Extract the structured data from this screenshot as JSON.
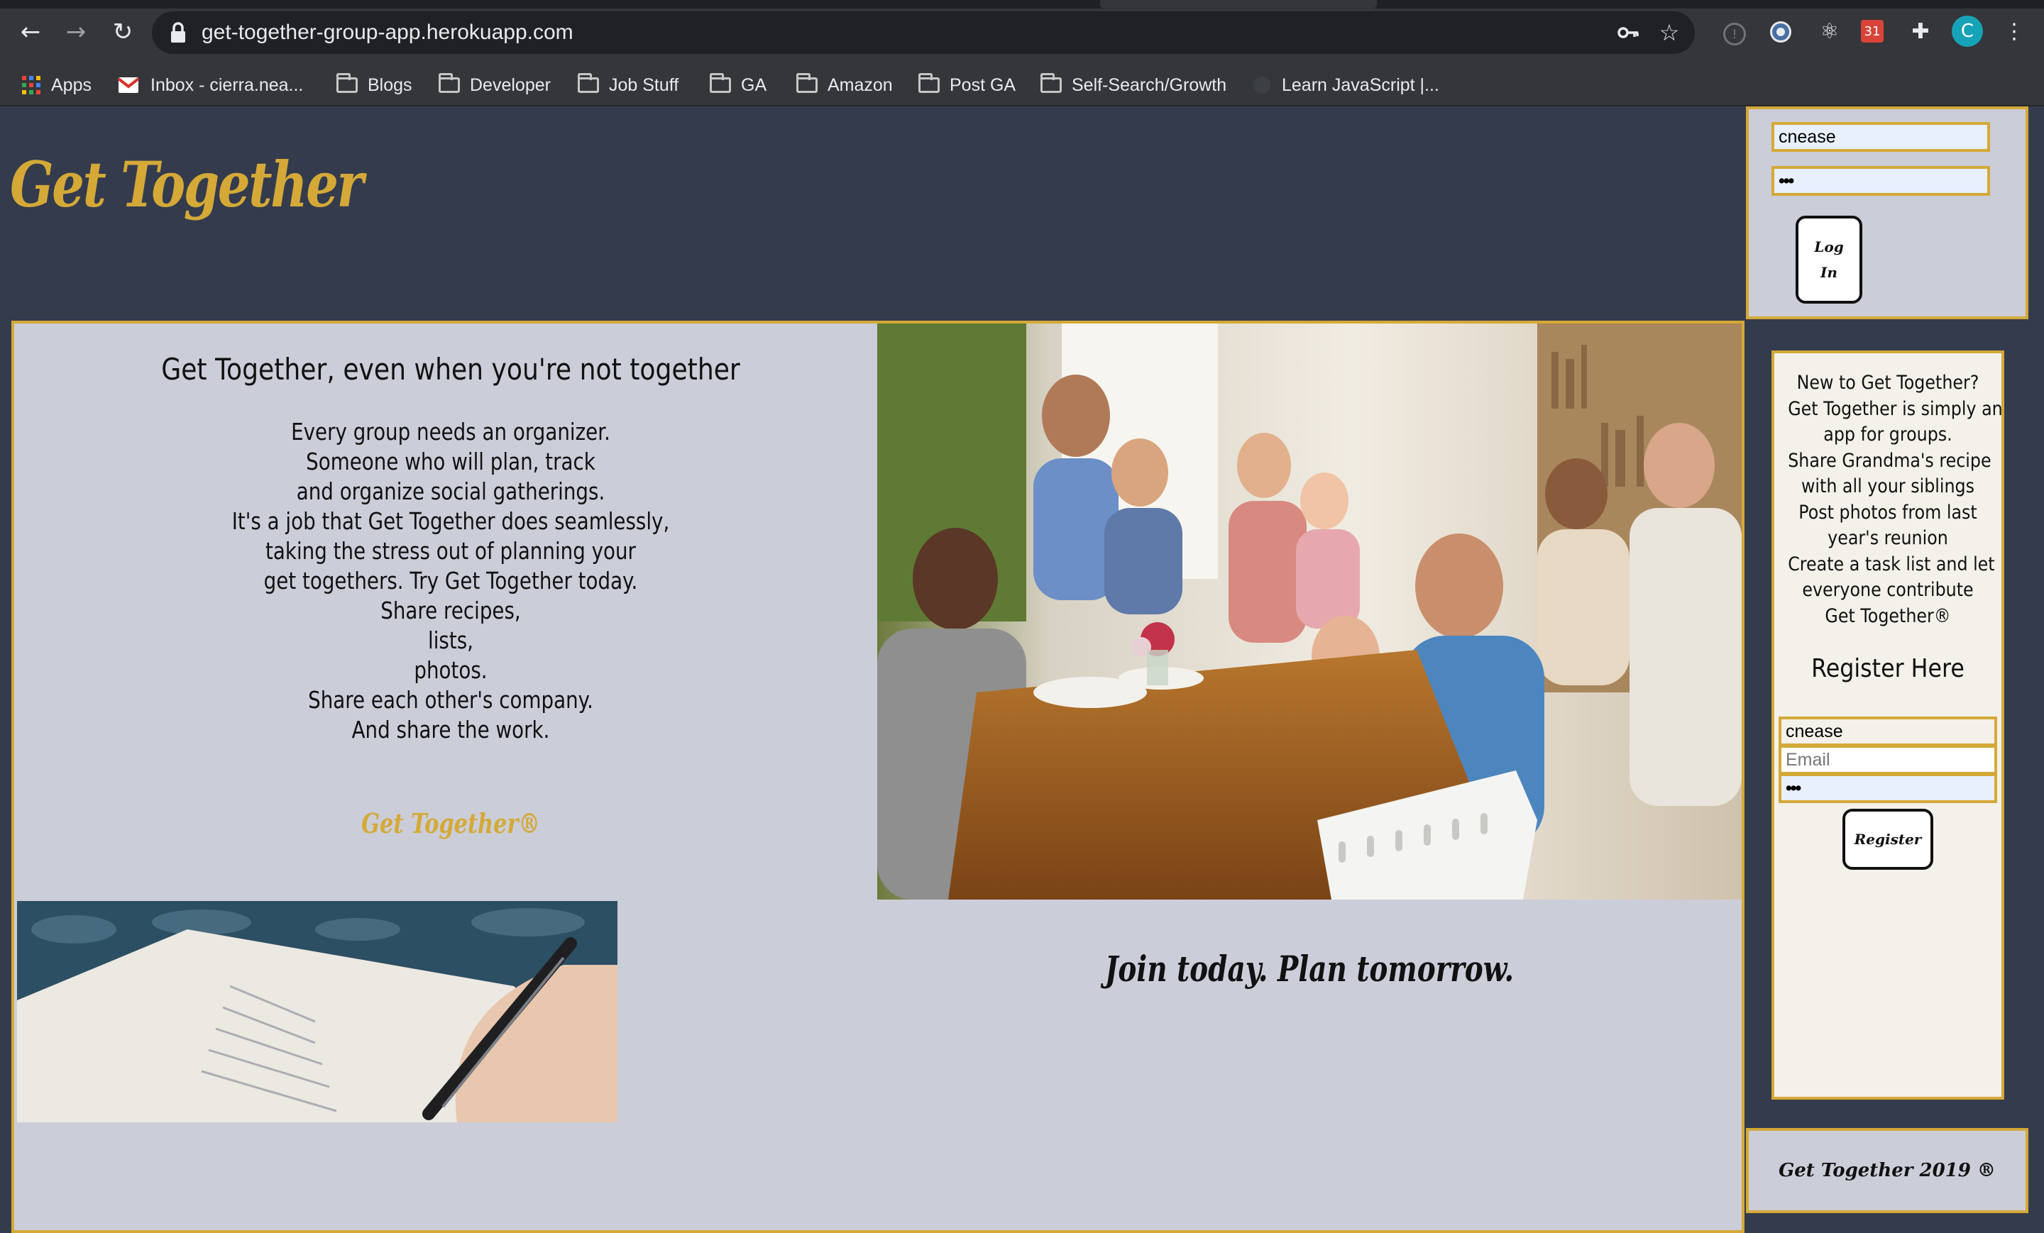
{
  "browser": {
    "url": "get-together-group-app.herokuapp.com",
    "profile_initial": "C",
    "bookmarks": [
      {
        "label": "Apps",
        "icon": "apps-grid-icon"
      },
      {
        "label": "Inbox - cierra.nea...",
        "icon": "gmail-icon"
      },
      {
        "label": "Blogs",
        "icon": "folder-icon"
      },
      {
        "label": "Developer",
        "icon": "folder-icon"
      },
      {
        "label": "Job Stuff",
        "icon": "folder-icon"
      },
      {
        "label": "GA",
        "icon": "folder-icon"
      },
      {
        "label": "Amazon",
        "icon": "folder-icon"
      },
      {
        "label": "Post GA",
        "icon": "folder-icon"
      },
      {
        "label": "Self-Search/Growth",
        "icon": "folder-icon"
      },
      {
        "label": "Learn JavaScript |...",
        "icon": "site-icon"
      }
    ]
  },
  "site": {
    "logo": "Get Together",
    "login": {
      "username_value": "cnease",
      "password_value": "•••",
      "button_label_line1": "Log",
      "button_label_line2": "In"
    },
    "main": {
      "headline": "Get Together, even when you're not together",
      "intro_lines": [
        "Every group needs an organizer.",
        "Someone who will plan, track",
        "and organize social gatherings.",
        "It's a job that Get Together does seamlessly,",
        "taking the stress out of planning your",
        "get togethers. Try Get Together today.",
        "Share recipes,",
        "lists,",
        "photos.",
        "Share each other's company.",
        "And share the work."
      ],
      "brand_mark": "Get Together®",
      "tagline": "Join today. Plan tomorrow."
    },
    "register": {
      "copy_lines": [
        "New to Get Together?",
        "Get Together is simply an",
        "app for groups.",
        "Share Grandma's recipe",
        "with all your siblings",
        "Post photos from last",
        "year's reunion",
        "Create a task list and let",
        "everyone contribute",
        "Get Together®"
      ],
      "heading": "Register Here",
      "username_value": "cnease",
      "email_placeholder": "Email",
      "password_value": "•••",
      "button_label": "Register"
    },
    "footer": "Get Together 2019 ®"
  },
  "colors": {
    "page_bg": "#343b4d",
    "panel_bg": "#cbced8",
    "accent_gold": "#d4a937",
    "register_bg": "#f4f1ea"
  }
}
